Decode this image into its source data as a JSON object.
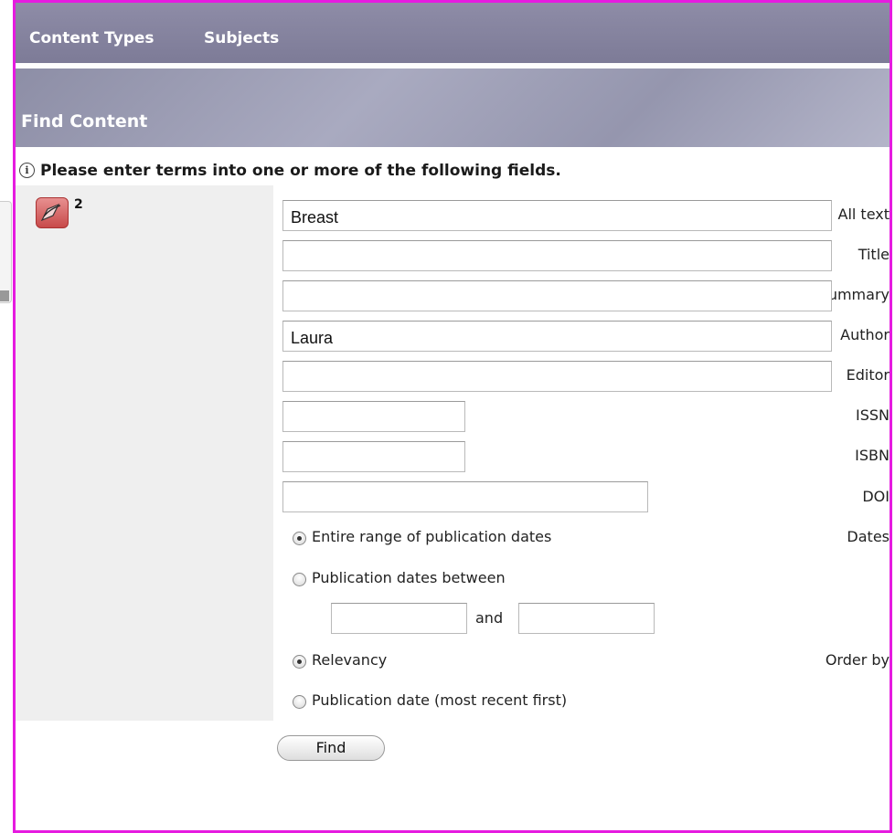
{
  "nav": {
    "items": [
      "Content Types",
      "Subjects"
    ]
  },
  "header": {
    "title": "Find Content"
  },
  "notice": {
    "text": "Please enter terms into one or more of the following fields."
  },
  "badge": {
    "count": "2",
    "icon": "annotation-icon"
  },
  "fields": {
    "all_text": {
      "label": "All text",
      "value": "Breast"
    },
    "title": {
      "label": "Title",
      "value": ""
    },
    "summary": {
      "label": "Summary",
      "value": ""
    },
    "author": {
      "label": "Author",
      "value": "Laura"
    },
    "editor": {
      "label": "Editor",
      "value": ""
    },
    "issn": {
      "label": "ISSN",
      "value": ""
    },
    "isbn": {
      "label": "ISBN",
      "value": ""
    },
    "doi": {
      "label": "DOI",
      "value": ""
    }
  },
  "dates": {
    "label": "Dates",
    "option_entire": "Entire range of publication dates",
    "option_between": "Publication dates between",
    "and_label": "and",
    "from": "",
    "to": "",
    "selected": "entire"
  },
  "order": {
    "label": "Order by",
    "option_relevancy": "Relevancy",
    "option_date": "Publication date (most recent first)",
    "selected": "relevancy"
  },
  "find_button": "Find",
  "colors": {
    "border": "#e61be0",
    "nav_bg": "#8e8ca7",
    "label_bg": "#efefef"
  }
}
